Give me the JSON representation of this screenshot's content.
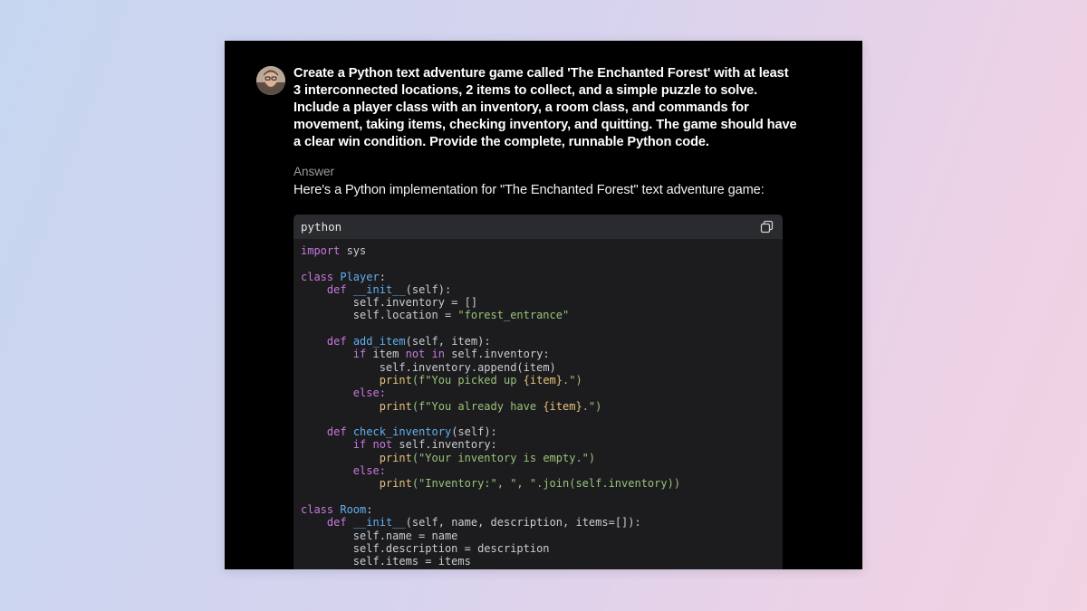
{
  "prompt": {
    "line1": "Create a Python text adventure game called 'The Enchanted Forest' with at least",
    "line2": "3 interconnected locations, 2 items to collect, and a simple puzzle to solve.",
    "line3": "Include a player class with an inventory, a room class, and commands for",
    "line4": "movement, taking items, checking inventory, and quitting. The game should have",
    "line5": "a clear win condition. Provide the complete, runnable Python code."
  },
  "answer": {
    "label": "Answer",
    "intro": "Here's a Python implementation for \"The Enchanted Forest\" text adventure game:"
  },
  "code": {
    "language": "python",
    "copy_icon": "copy-icon",
    "tokens": {
      "import": "import",
      "sys": " sys",
      "class": "class",
      "Player": "Player",
      "Room": "Room",
      "def": "def",
      "init": "__init__",
      "add_item": "add_item",
      "check_inventory": "check_inventory",
      "if": "if",
      "not": "not",
      "in": "in",
      "else": "else:",
      "print": "print",
      "self_param": "(self):",
      "l_inv_init": "self.inventory = []",
      "l_loc_pre": "self.location = ",
      "l_loc_str": "\"forest_entrance\"",
      "add_params": "(self, item):",
      "item_sp": " item ",
      "self_inv_colon": " self.inventory:",
      "append": "self.inventory.append(item)",
      "f_pick_a": "(f\"You picked up ",
      "brace_item": "{item}",
      "f_end": ".\")",
      "f_have_a": "(f\"You already have ",
      "not_self_inv": " self.inventory:",
      "empty_str": "(\"Your inventory is empty.\")",
      "inv_str": "(\"Inventory:\", \", \".join(self.inventory))",
      "room_params": "(self, name, description, items=[]):",
      "l_name": "self.name = name",
      "l_desc": "self.description = description",
      "l_items": "self.items = items",
      "colon": ":"
    }
  },
  "colors": {
    "window_bg": "#000000",
    "code_bg": "#1c1c1e",
    "keyword": "#c678dd",
    "class_name": "#61afef",
    "string": "#98c379",
    "builtin": "#e5c07b"
  }
}
